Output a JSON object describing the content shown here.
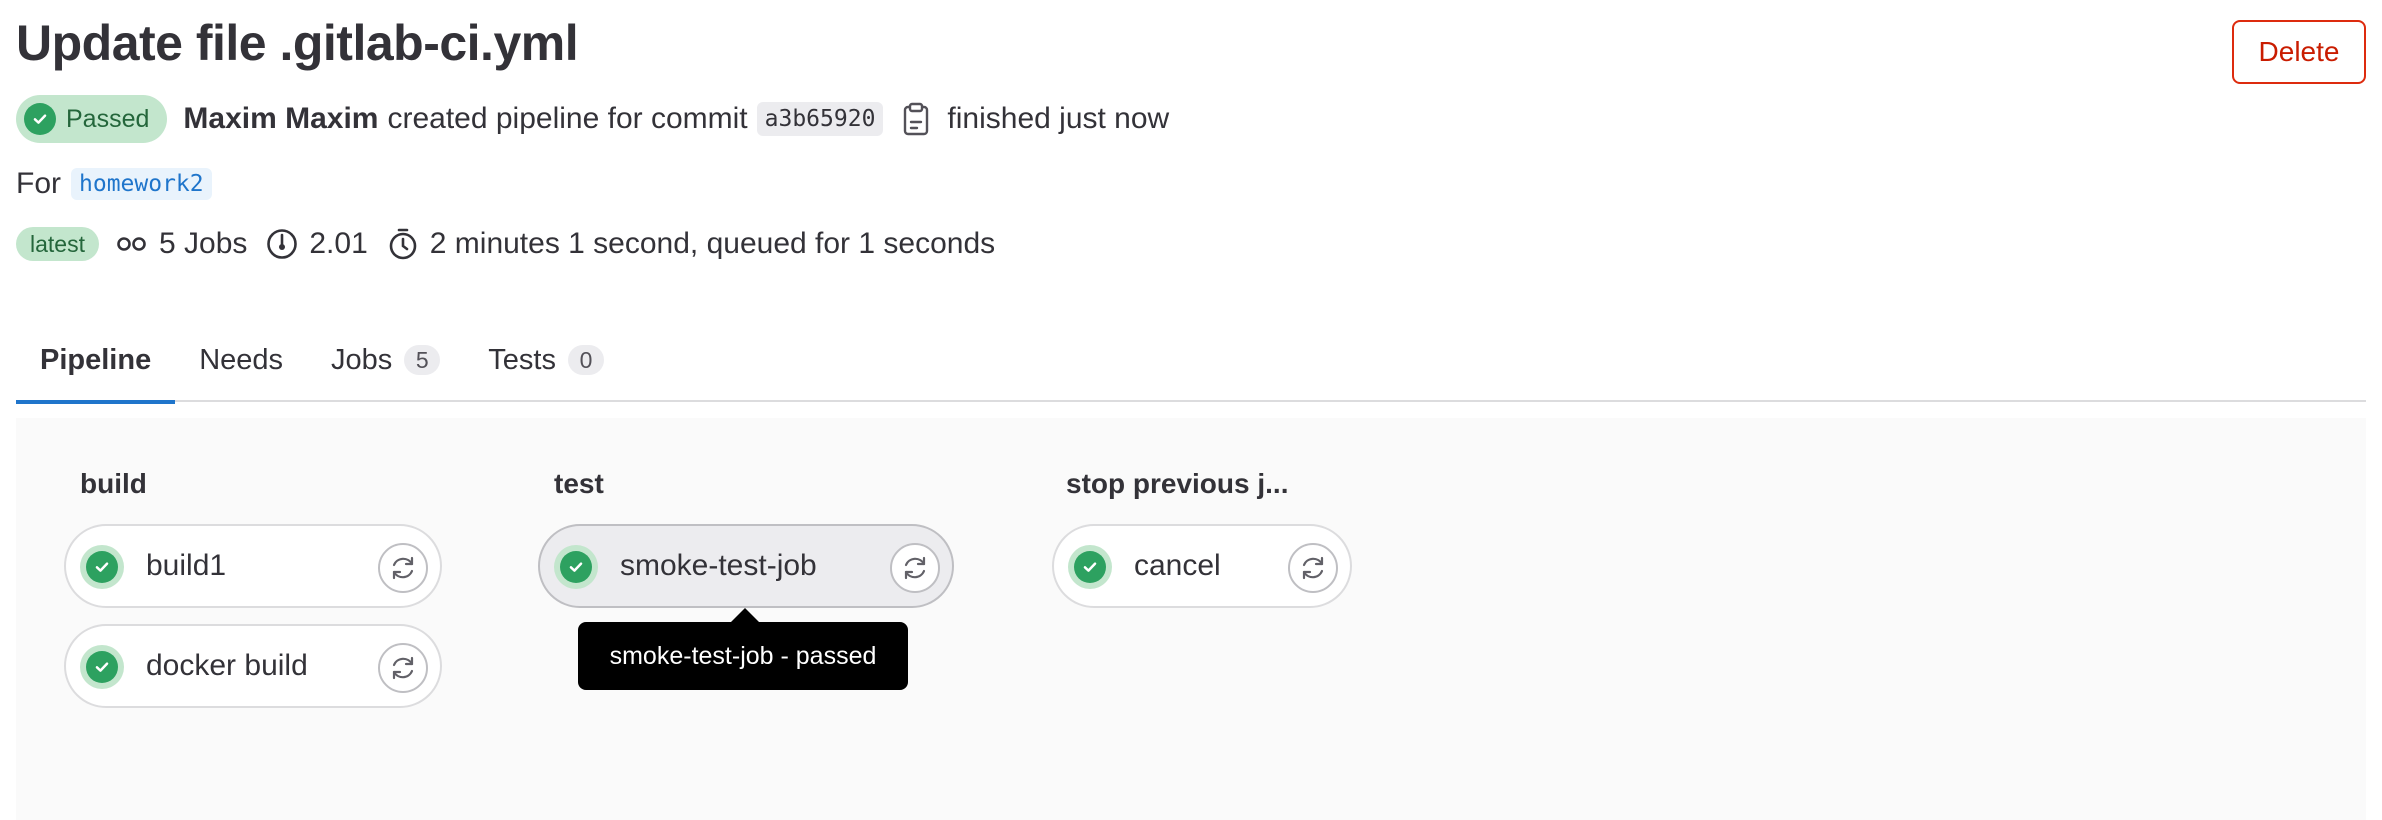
{
  "header": {
    "title": "Update file .gitlab-ci.yml",
    "delete_label": "Delete"
  },
  "pipeline_info": {
    "status": "Passed",
    "author": "Maxim Maxim",
    "action_text": "created pipeline for commit",
    "commit_sha": "a3b65920",
    "finished_text": "finished just now",
    "for_label": "For",
    "branch": "homework2",
    "latest_label": "latest",
    "jobs_text": "5 Jobs",
    "compute_text": "2.01",
    "duration_text": "2 minutes 1 second, queued for 1 seconds"
  },
  "tabs": [
    {
      "label": "Pipeline"
    },
    {
      "label": "Needs"
    },
    {
      "label": "Jobs",
      "count": "5"
    },
    {
      "label": "Tests",
      "count": "0"
    }
  ],
  "stages": [
    {
      "name": "build",
      "jobs": [
        {
          "name": "build1"
        },
        {
          "name": "docker build"
        }
      ]
    },
    {
      "name": "test",
      "jobs": [
        {
          "name": "smoke-test-job"
        }
      ]
    },
    {
      "name": "stop previous j...",
      "jobs": [
        {
          "name": "cancel"
        }
      ]
    }
  ],
  "tooltip": {
    "text": "smoke-test-job - passed"
  },
  "colors": {
    "success": "#2da160",
    "success_bg": "#c3e6cd",
    "danger": "#dd2b0e",
    "link": "#1f75cb",
    "tab_underline": "#1f75cb"
  },
  "icons": {
    "status": "check-circle-icon",
    "copy": "copy-to-clipboard-icon",
    "jobs": "pipeline-jobs-icon",
    "compute": "compute-dashboard-icon",
    "duration": "timer-icon",
    "retry": "retry-icon"
  }
}
